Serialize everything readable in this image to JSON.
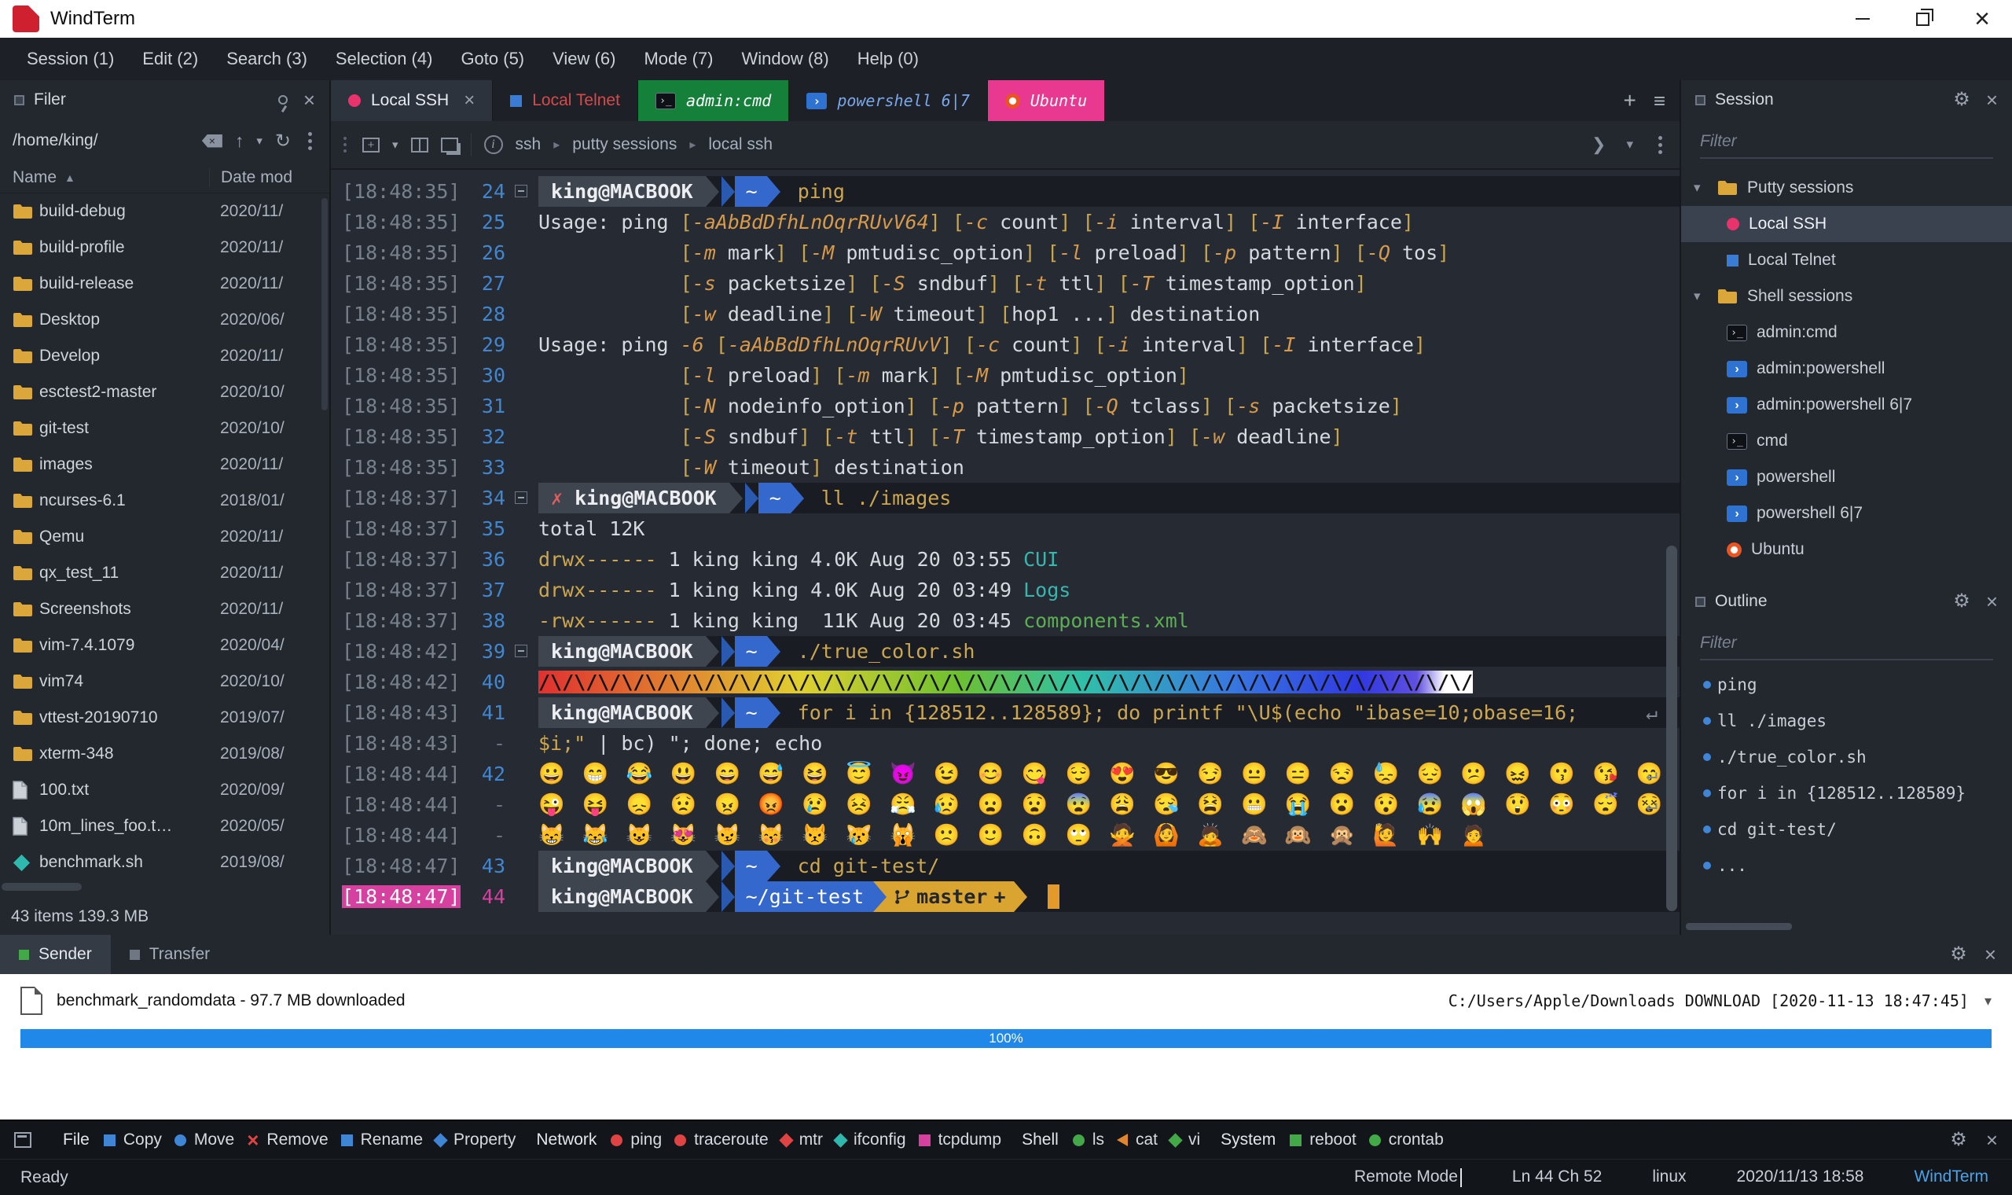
{
  "window": {
    "title": "WindTerm"
  },
  "menu": {
    "items": [
      {
        "label": "Session (1)"
      },
      {
        "label": "Edit (2)"
      },
      {
        "label": "Search (3)"
      },
      {
        "label": "Selection (4)"
      },
      {
        "label": "Goto (5)"
      },
      {
        "label": "View (6)"
      },
      {
        "label": "Mode (7)"
      },
      {
        "label": "Window (8)"
      },
      {
        "label": "Help (0)"
      }
    ]
  },
  "filer": {
    "title": "Filer",
    "path": "/home/king/",
    "columns": {
      "name": "Name",
      "date": "Date mod"
    },
    "status": "43 items 139.3 MB",
    "items": [
      {
        "name": "build-debug",
        "date": "2020/11/",
        "type": "folder"
      },
      {
        "name": "build-profile",
        "date": "2020/11/",
        "type": "folder"
      },
      {
        "name": "build-release",
        "date": "2020/11/",
        "type": "folder"
      },
      {
        "name": "Desktop",
        "date": "2020/06/",
        "type": "folder"
      },
      {
        "name": "Develop",
        "date": "2020/11/",
        "type": "folder"
      },
      {
        "name": "esctest2-master",
        "date": "2020/10/",
        "type": "folder"
      },
      {
        "name": "git-test",
        "date": "2020/10/",
        "type": "folder"
      },
      {
        "name": "images",
        "date": "2020/11/",
        "type": "folder"
      },
      {
        "name": "ncurses-6.1",
        "date": "2018/01/",
        "type": "folder"
      },
      {
        "name": "Qemu",
        "date": "2020/11/",
        "type": "folder"
      },
      {
        "name": "qx_test_11",
        "date": "2020/11/",
        "type": "folder"
      },
      {
        "name": "Screenshots",
        "date": "2020/11/",
        "type": "folder"
      },
      {
        "name": "vim-7.4.1079",
        "date": "2020/04/",
        "type": "folder"
      },
      {
        "name": "vim74",
        "date": "2020/10/",
        "type": "folder"
      },
      {
        "name": "vttest-20190710",
        "date": "2019/07/",
        "type": "folder"
      },
      {
        "name": "xterm-348",
        "date": "2019/08/",
        "type": "folder"
      },
      {
        "name": "100.txt",
        "date": "2020/09/",
        "type": "file"
      },
      {
        "name": "10m_lines_foo.t…",
        "date": "2020/05/",
        "type": "file"
      },
      {
        "name": "benchmark.sh",
        "date": "2019/08/",
        "type": "script"
      }
    ]
  },
  "tabs": {
    "items": [
      {
        "label": "Local SSH",
        "type": "ssh",
        "active": true
      },
      {
        "label": "Local Telnet",
        "type": "telnet"
      },
      {
        "label": "admin:cmd",
        "type": "cmd"
      },
      {
        "label": "powershell 6|7",
        "type": "powershell"
      },
      {
        "label": "Ubuntu",
        "type": "ubuntu"
      }
    ]
  },
  "breadcrumb": {
    "segments": [
      "ssh",
      "putty sessions",
      "local ssh"
    ]
  },
  "terminal": {
    "lines": [
      {
        "ts": "18:48:35",
        "num": "24",
        "fold": true,
        "kind": "prompt",
        "user": "king@MACBOOK",
        "path": "~",
        "cmd": "ping"
      },
      {
        "ts": "18:48:35",
        "num": "25",
        "kind": "usage",
        "text": "Usage: ping [-aAbBdDfhLnOqrRUvV64] [-c count] [-i interval] [-I interface]"
      },
      {
        "ts": "18:48:35",
        "num": "26",
        "kind": "usage",
        "text": "            [-m mark] [-M pmtudisc_option] [-l preload] [-p pattern] [-Q tos]"
      },
      {
        "ts": "18:48:35",
        "num": "27",
        "kind": "usage",
        "text": "            [-s packetsize] [-S sndbuf] [-t ttl] [-T timestamp_option]"
      },
      {
        "ts": "18:48:35",
        "num": "28",
        "kind": "usage",
        "text": "            [-w deadline] [-W timeout] [hop1 ...] destination"
      },
      {
        "ts": "18:48:35",
        "num": "29",
        "kind": "usage",
        "text": "Usage: ping -6 [-aAbBdDfhLnOqrRUvV] [-c count] [-i interval] [-I interface]"
      },
      {
        "ts": "18:48:35",
        "num": "30",
        "kind": "usage",
        "text": "            [-l preload] [-m mark] [-M pmtudisc_option]"
      },
      {
        "ts": "18:48:35",
        "num": "31",
        "kind": "usage",
        "text": "            [-N nodeinfo_option] [-p pattern] [-Q tclass] [-s packetsize]"
      },
      {
        "ts": "18:48:35",
        "num": "32",
        "kind": "usage",
        "text": "            [-S sndbuf] [-t ttl] [-T timestamp_option] [-w deadline]"
      },
      {
        "ts": "18:48:35",
        "num": "33",
        "kind": "usage",
        "text": "            [-W timeout] destination"
      },
      {
        "ts": "18:48:37",
        "num": "34",
        "fold": true,
        "kind": "prompt",
        "err": true,
        "user": "king@MACBOOK",
        "path": "~",
        "cmd": "ll ./images"
      },
      {
        "ts": "18:48:37",
        "num": "35",
        "kind": "plain",
        "text": "total 12K"
      },
      {
        "ts": "18:48:37",
        "num": "36",
        "kind": "ls",
        "segs": [
          {
            "t": "drwx------",
            "c": "p"
          },
          {
            "t": " 1 king king 4.0K Aug 20 03:55 ",
            "c": "w"
          },
          {
            "t": "CUI",
            "c": "d"
          }
        ]
      },
      {
        "ts": "18:48:37",
        "num": "37",
        "kind": "ls",
        "segs": [
          {
            "t": "drwx------",
            "c": "p"
          },
          {
            "t": " 1 king king 4.0K Aug 20 03:49 ",
            "c": "w"
          },
          {
            "t": "Logs",
            "c": "d"
          }
        ]
      },
      {
        "ts": "18:48:37",
        "num": "38",
        "kind": "ls",
        "segs": [
          {
            "t": "-rwx------",
            "c": "p"
          },
          {
            "t": " 1 king king  11K Aug 20 03:45 ",
            "c": "w"
          },
          {
            "t": "components.xml",
            "c": "g"
          }
        ]
      },
      {
        "ts": "18:48:42",
        "num": "39",
        "fold": true,
        "kind": "prompt",
        "user": "king@MACBOOK",
        "path": "~",
        "cmd": "./true_color.sh"
      },
      {
        "ts": "18:48:42",
        "num": "40",
        "kind": "rainbow",
        "pattern": "/\\",
        "repeat": 39,
        "tail": "/"
      },
      {
        "ts": "18:48:43",
        "num": "41",
        "kind": "prompt",
        "user": "king@MACBOOK",
        "path": "~",
        "cmd": "for i in {128512..128589}; do printf \"\\U$(echo \"ibase=10;obase=16;",
        "wrap": true
      },
      {
        "ts": "18:48:43",
        "num": "-",
        "kind": "ls",
        "segs": [
          {
            "t": "$i;\" ",
            "c": "y"
          },
          {
            "t": "| bc) \"; done; echo",
            "c": "w"
          }
        ]
      },
      {
        "ts": "18:48:44",
        "num": "42",
        "kind": "emoji",
        "wrap": true,
        "text": "😀 😁 😂 😃 😄 😅 😆 😇 😈 😉 😊 😋 😌 😍 😎 😏 😐 😑 😒 😓 😔 😕 😖 😗 😘 😙 😚 😛"
      },
      {
        "ts": "18:48:44",
        "num": "-",
        "kind": "emoji",
        "wrap": true,
        "text": "😜 😝 😞 😟 😠 😡 😢 😣 😤 😥 😦 😧 😨 😩 😪 😫 😬 😭 😮 😯 😰 😱 😲 😳 😴 😵 😶 😷"
      },
      {
        "ts": "18:48:44",
        "num": "-",
        "kind": "emoji",
        "text": "😸 😹 😺 😻 😼 😽 😾 😿 🙀 🙁 🙂 🙃 🙄 🙅 🙆 🙇 🙈 🙉 🙊 🙋 🙌 🙍"
      },
      {
        "ts": "18:48:47",
        "num": "43",
        "kind": "prompt",
        "user": "king@MACBOOK",
        "path": "~",
        "cmd": "cd git-test/"
      },
      {
        "ts": "18:48:47",
        "num": "44",
        "hl": true,
        "kind": "prompt",
        "user": "king@MACBOOK",
        "path": "~/git-test",
        "git": "master",
        "cursor": true
      }
    ]
  },
  "session_panel": {
    "title": "Session",
    "filter_placeholder": "Filter",
    "groups": [
      {
        "label": "Putty sessions",
        "items": [
          {
            "label": "Local SSH",
            "icon": "ssh",
            "selected": true
          },
          {
            "label": "Local Telnet",
            "icon": "telnet"
          }
        ]
      },
      {
        "label": "Shell sessions",
        "items": [
          {
            "label": "admin:cmd",
            "icon": "cmd"
          },
          {
            "label": "admin:powershell",
            "icon": "powershell"
          },
          {
            "label": "admin:powershell 6|7",
            "icon": "powershell"
          },
          {
            "label": "cmd",
            "icon": "cmd"
          },
          {
            "label": "powershell",
            "icon": "powershell"
          },
          {
            "label": "powershell 6|7",
            "icon": "powershell"
          },
          {
            "label": "Ubuntu",
            "icon": "ubuntu"
          }
        ]
      }
    ]
  },
  "outline_panel": {
    "title": "Outline",
    "filter_placeholder": "Filter",
    "items": [
      "ping",
      "ll ./images",
      "./true_color.sh",
      "for i in {128512..128589}",
      "cd git-test/",
      "..."
    ]
  },
  "transfer": {
    "tabs": [
      {
        "label": "Sender",
        "active": true
      },
      {
        "label": "Transfer"
      }
    ],
    "file_label": "benchmark_randomdata - 97.7 MB downloaded",
    "destination": "C:/Users/Apple/Downloads DOWNLOAD [2020-11-13 18:47:45]",
    "progress_percent": 100,
    "progress_label": "100%"
  },
  "toolbar": {
    "groups": [
      {
        "label": "File",
        "items": [
          {
            "label": "Copy",
            "shape": "square",
            "color": "#3f85d6"
          },
          {
            "label": "Move",
            "shape": "circle",
            "color": "#3f85d6"
          },
          {
            "label": "Remove",
            "shape": "cross",
            "color": "#e04343"
          },
          {
            "label": "Rename",
            "shape": "square",
            "color": "#3f85d6"
          },
          {
            "label": "Property",
            "shape": "diamond",
            "color": "#3f85d6"
          }
        ]
      },
      {
        "label": "Network",
        "items": [
          {
            "label": "ping",
            "shape": "circle",
            "color": "#e04343"
          },
          {
            "label": "traceroute",
            "shape": "circle",
            "color": "#e04343"
          },
          {
            "label": "mtr",
            "shape": "diamond",
            "color": "#e04343"
          },
          {
            "label": "ifconfig",
            "shape": "diamond",
            "color": "#2fb8ad"
          },
          {
            "label": "tcpdump",
            "shape": "square",
            "color": "#d6409f"
          }
        ]
      },
      {
        "label": "Shell",
        "items": [
          {
            "label": "ls",
            "shape": "circle",
            "color": "#43a847"
          },
          {
            "label": "cat",
            "shape": "triangle",
            "color": "#e0862f"
          },
          {
            "label": "vi",
            "shape": "diamond",
            "color": "#43a847"
          }
        ]
      },
      {
        "label": "System",
        "items": [
          {
            "label": "reboot",
            "shape": "square",
            "color": "#43a847"
          },
          {
            "label": "crontab",
            "shape": "circle",
            "color": "#43a847"
          }
        ]
      }
    ]
  },
  "statusbar": {
    "ready": "Ready",
    "mode": "Remote Mode",
    "position": "Ln 44 Ch 52",
    "os": "linux",
    "datetime": "2020/11/13 18:58",
    "app": "WindTerm"
  }
}
